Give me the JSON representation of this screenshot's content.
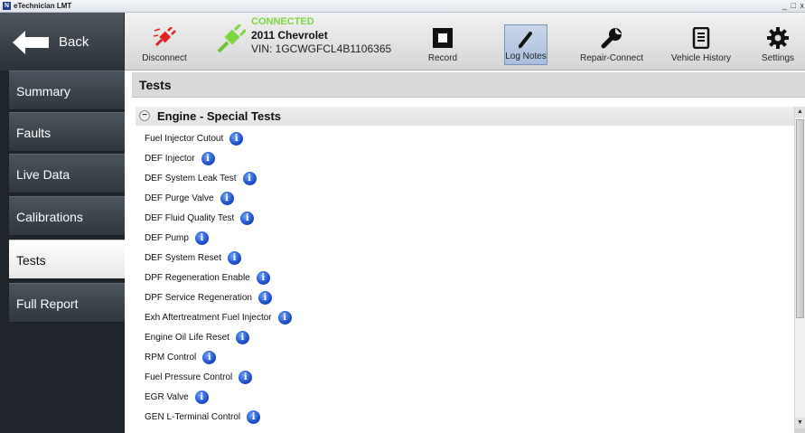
{
  "window": {
    "title": "eTechnician LMT",
    "app_icon": "N",
    "controls": "_ □ x"
  },
  "back_button": {
    "label": "Back",
    "icon": "back-arrow-icon"
  },
  "toolbar": {
    "disconnect_label": "Disconnect",
    "connection": {
      "status": "CONNECTED",
      "vehicle": "2011 Chevrolet",
      "vin": "VIN: 1GCWGFCL4B1106365"
    },
    "record_label": "Record",
    "log_notes_label": "Log Notes",
    "repair_connect_label": "Repair-Connect",
    "vehicle_history_label": "Vehicle History",
    "settings_label": "Settings"
  },
  "sidebar": {
    "items": [
      {
        "label": "Summary"
      },
      {
        "label": "Faults"
      },
      {
        "label": "Live Data"
      },
      {
        "label": "Calibrations"
      },
      {
        "label": "Tests",
        "active": true
      },
      {
        "label": "Full Report"
      }
    ]
  },
  "main": {
    "header": "Tests",
    "section": {
      "collapse_symbol": "−",
      "title": "Engine - Special Tests"
    },
    "tests": [
      "Fuel Injector Cutout",
      "DEF Injector",
      "DEF System Leak Test",
      "DEF Purge Valve",
      "DEF Fluid Quality Test",
      "DEF Pump",
      "DEF System Reset",
      "DPF Regeneration Enable",
      "DPF Service Regeneration",
      "Exh Aftertreatment Fuel Injector",
      "Engine Oil Life Reset",
      "RPM Control",
      "Fuel Pressure Control",
      "EGR Valve",
      "GEN L-Terminal Control"
    ],
    "info_glyph": "i"
  },
  "colors": {
    "connected_green": "#7dd640",
    "info_blue": "#1c4fc9",
    "sidebar_dark": "#1e2429",
    "active_tool": "#a9bedf"
  }
}
